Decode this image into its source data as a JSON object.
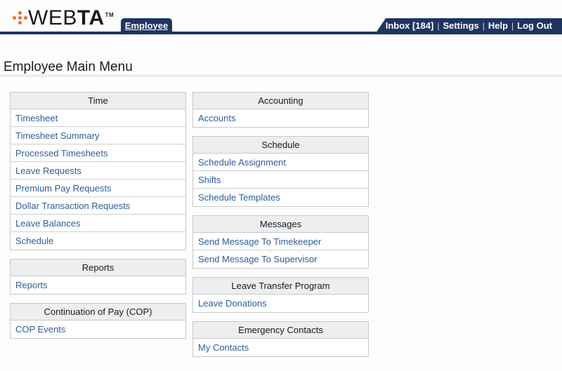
{
  "header": {
    "logo_text_light": "WEB",
    "logo_text_bold": "TA",
    "logo_tm": "TM",
    "active_tab": "Employee",
    "user_nav": [
      {
        "label": "Inbox [184]"
      },
      {
        "label": "Settings"
      },
      {
        "label": "Help"
      },
      {
        "label": "Log Out"
      }
    ],
    "separator": "|"
  },
  "page_title": "Employee Main Menu",
  "colors": {
    "brand_navy": "#1f3461",
    "logo_orange": "#f26a2e",
    "link_blue": "#2e5d99",
    "header_gray": "#eceef0"
  },
  "menus": {
    "left": [
      {
        "title": "Time",
        "items": [
          "Timesheet",
          "Timesheet Summary",
          "Processed Timesheets",
          "Leave Requests",
          "Premium Pay Requests",
          "Dollar Transaction Requests",
          "Leave Balances",
          "Schedule"
        ]
      },
      {
        "title": "Reports",
        "items": [
          "Reports"
        ]
      },
      {
        "title": "Continuation of Pay (COP)",
        "items": [
          "COP Events"
        ]
      }
    ],
    "right": [
      {
        "title": "Accounting",
        "items": [
          "Accounts"
        ]
      },
      {
        "title": "Schedule",
        "items": [
          "Schedule Assignment",
          "Shifts",
          "Schedule Templates"
        ]
      },
      {
        "title": "Messages",
        "items": [
          "Send Message To Timekeeper",
          "Send Message To Supervisor"
        ]
      },
      {
        "title": "Leave Transfer Program",
        "items": [
          "Leave Donations"
        ]
      },
      {
        "title": "Emergency Contacts",
        "items": [
          "My Contacts"
        ]
      }
    ]
  }
}
